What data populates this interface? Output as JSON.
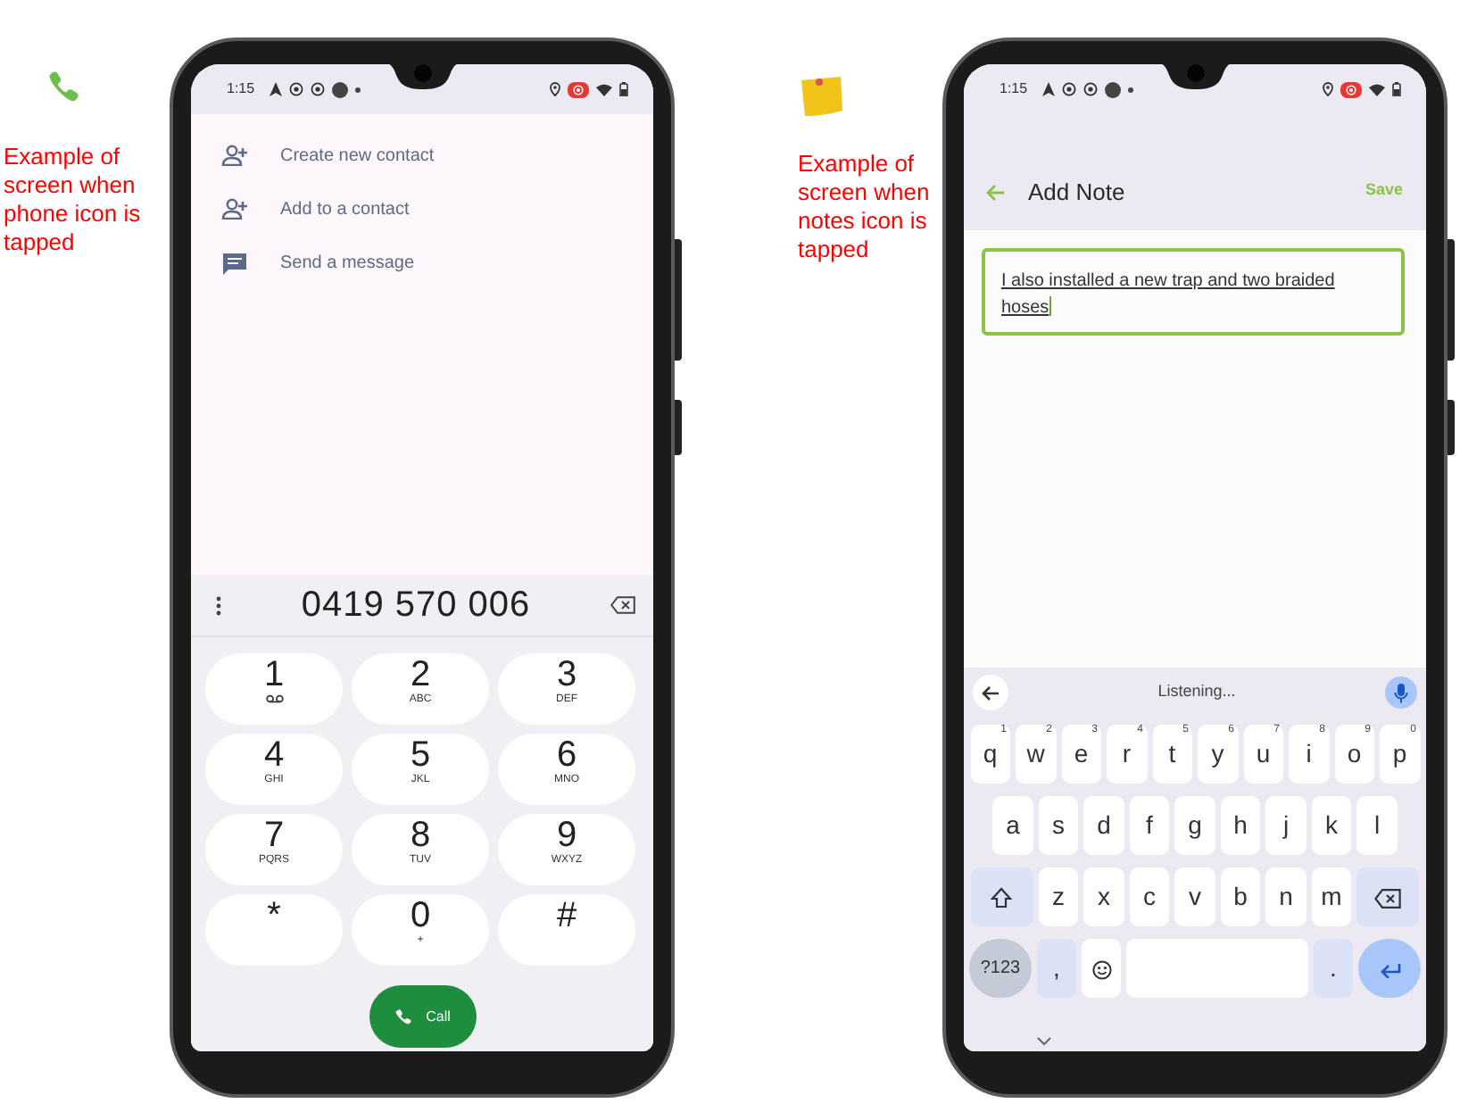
{
  "phones": [
    {
      "kind": "dialer",
      "caption": "Example of screen when phone icon is tapped",
      "status_bar": {
        "time": "1:15"
      },
      "contact_actions": [
        {
          "kind": "add-person",
          "label": "Create new contact"
        },
        {
          "kind": "add-person",
          "label": "Add to a contact"
        },
        {
          "kind": "message",
          "label": "Send a message"
        }
      ],
      "number": "0419 570 006",
      "keys": [
        {
          "digit": "1",
          "kind": "voicemail"
        },
        {
          "digit": "2",
          "letters": "ABC"
        },
        {
          "digit": "3",
          "letters": "DEF"
        },
        {
          "digit": "4",
          "letters": "GHI"
        },
        {
          "digit": "5",
          "letters": "JKL"
        },
        {
          "digit": "6",
          "letters": "MNO"
        },
        {
          "digit": "7",
          "letters": "PQRS"
        },
        {
          "digit": "8",
          "letters": "TUV"
        },
        {
          "digit": "9",
          "letters": "WXYZ"
        },
        {
          "digit": "*"
        },
        {
          "digit": "0",
          "letters": "+"
        },
        {
          "digit": "#"
        }
      ],
      "call_button": "Call"
    },
    {
      "kind": "note",
      "caption": "Example of screen when notes icon is tapped",
      "status_bar": {
        "time": "1:15"
      },
      "title": "Add Note",
      "action": "Save",
      "note_text": "I also installed a new trap and two braided hoses",
      "keyboard": {
        "suggestion": "Listening...",
        "rows": [
          {
            "keys": [
              {
                "kind": "char",
                "label": "q",
                "hint": "1"
              },
              {
                "kind": "char",
                "label": "w",
                "hint": "2"
              },
              {
                "kind": "char",
                "label": "e",
                "hint": "3"
              },
              {
                "kind": "char",
                "label": "r",
                "hint": "4"
              },
              {
                "kind": "char",
                "label": "t",
                "hint": "5"
              },
              {
                "kind": "char",
                "label": "y",
                "hint": "6"
              },
              {
                "kind": "char",
                "label": "u",
                "hint": "7"
              },
              {
                "kind": "char",
                "label": "i",
                "hint": "8"
              },
              {
                "kind": "char",
                "label": "o",
                "hint": "9"
              },
              {
                "kind": "char",
                "label": "p",
                "hint": "0"
              }
            ]
          },
          {
            "keys": [
              {
                "kind": "char",
                "label": "a"
              },
              {
                "kind": "char",
                "label": "s"
              },
              {
                "kind": "char",
                "label": "d"
              },
              {
                "kind": "char",
                "label": "f"
              },
              {
                "kind": "char",
                "label": "g"
              },
              {
                "kind": "char",
                "label": "h"
              },
              {
                "kind": "char",
                "label": "j"
              },
              {
                "kind": "char",
                "label": "k"
              },
              {
                "kind": "char",
                "label": "l"
              }
            ]
          },
          {
            "keys": [
              {
                "kind": "shift"
              },
              {
                "kind": "char",
                "label": "z"
              },
              {
                "kind": "char",
                "label": "x"
              },
              {
                "kind": "char",
                "label": "c"
              },
              {
                "kind": "char",
                "label": "v"
              },
              {
                "kind": "char",
                "label": "b"
              },
              {
                "kind": "char",
                "label": "n"
              },
              {
                "kind": "char",
                "label": "m"
              },
              {
                "kind": "backspace"
              }
            ]
          },
          {
            "keys": [
              {
                "kind": "symbols",
                "label": "?123"
              },
              {
                "kind": "punct",
                "label": ","
              },
              {
                "kind": "emoji"
              },
              {
                "kind": "space"
              },
              {
                "kind": "punct",
                "label": "."
              },
              {
                "kind": "enter"
              }
            ]
          }
        ]
      }
    }
  ]
}
